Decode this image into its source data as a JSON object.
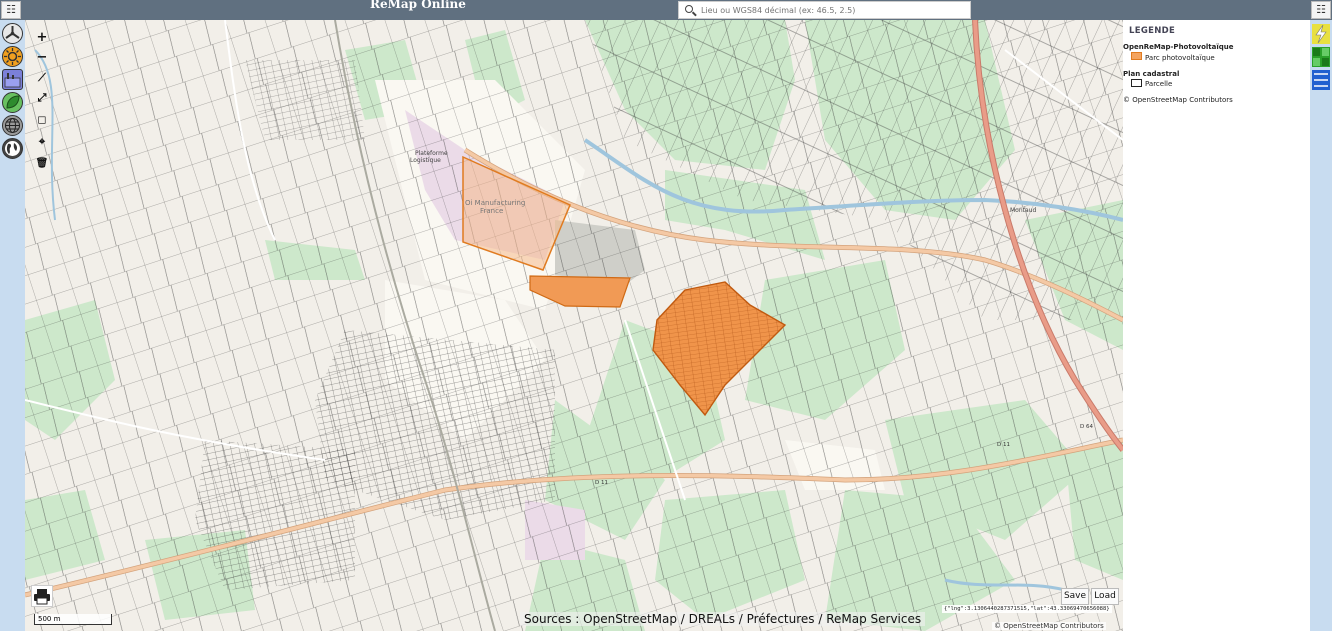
{
  "app": {
    "title": "ReMap Online"
  },
  "menu": {
    "left_icon": "menu-icon",
    "right_icon": "menu-icon",
    "glyph": "☷"
  },
  "search": {
    "placeholder": "Lieu ou WGS84 décimal (ex: 46.5, 2.5)"
  },
  "layer_buttons": [
    {
      "name": "wind-layer-icon"
    },
    {
      "name": "solar-layer-icon"
    },
    {
      "name": "industry-layer-icon"
    },
    {
      "name": "biomass-layer-icon"
    },
    {
      "name": "grid-globe-icon"
    },
    {
      "name": "world-globe-icon"
    }
  ],
  "draw_tools": [
    {
      "name": "zoom-in-button",
      "glyph": "+"
    },
    {
      "name": "zoom-out-button",
      "glyph": "−"
    },
    {
      "name": "draw-polyline-tool",
      "glyph": "⟋"
    },
    {
      "name": "draw-line-tool",
      "glyph": "⤢"
    },
    {
      "name": "draw-rectangle-tool",
      "glyph": "◻"
    },
    {
      "name": "draw-marker-tool",
      "glyph": "⌖"
    },
    {
      "name": "delete-tool",
      "glyph": "🗑"
    }
  ],
  "legend": {
    "title": "LEGENDE",
    "groups": [
      {
        "label": "OpenReMap-Photovoltaïque",
        "item": "Parc photovoltaïque",
        "swatch_fill": "#f4a460",
        "swatch_border": "#e07b20"
      },
      {
        "label": "Plan cadastral",
        "item": "Parcelle",
        "swatch_fill": "#ffffff",
        "swatch_border": "#222222"
      }
    ],
    "credit": "© OpenStreetMap Contributors"
  },
  "map": {
    "scale": "500 m",
    "sources": "Sources : OpenStreetMap / DREALs / Préfectures / ReMap Services",
    "coordinates": "{\"lng\":3.1306440287371515,\"lat\":43.33069470656088}",
    "credit": "© OpenStreetMap Contributors",
    "save_label": "Save",
    "load_label": "Load",
    "road_labels": [
      "D 11",
      "D 11",
      "D 64"
    ]
  },
  "colors": {
    "topbar": "#607080",
    "sidebar": "#c8dcf0",
    "land": "#f2efe9",
    "field": "#cde8cb",
    "solar": "#f19a55",
    "road": "#f4c9a5",
    "highway": "#e99c88",
    "water": "#9fc5dd"
  },
  "right_buttons": [
    {
      "name": "lightning-icon"
    },
    {
      "name": "green-grid-icon"
    },
    {
      "name": "blue-lines-icon"
    }
  ]
}
